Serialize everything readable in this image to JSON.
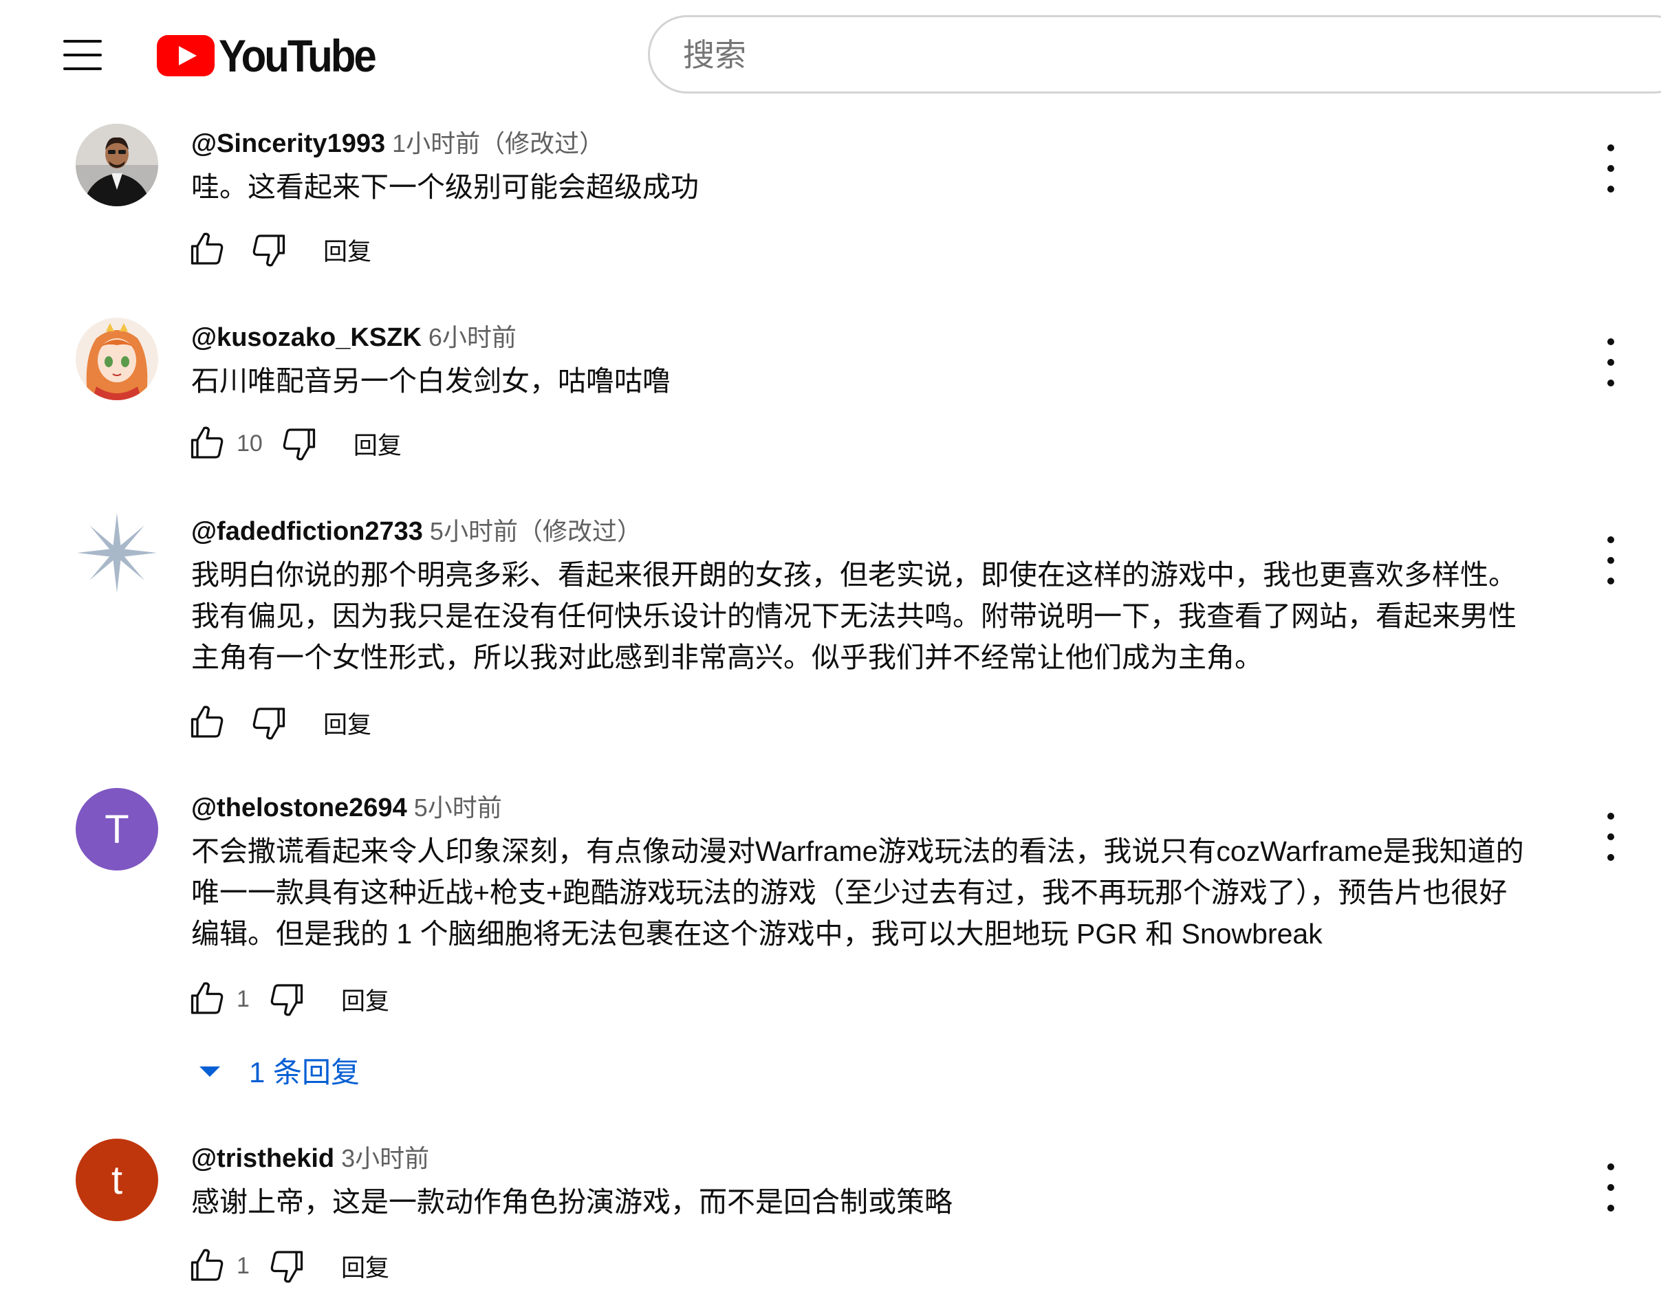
{
  "app": {
    "logo_text": "YouTube",
    "search_placeholder": "搜索"
  },
  "comments": [
    {
      "author": "@Sincerity1993",
      "time": "1小时前（修改过）",
      "lines": [
        "哇。这看起来下一个级别可能会超级成功"
      ],
      "likes": "",
      "reply_label": "回复",
      "avatar": {
        "type": "photo",
        "icon": "man-in-suit-avatar"
      }
    },
    {
      "author": "@kusozako_KSZK",
      "time": "6小时前",
      "lines": [
        "石川唯配音另一个白发剑女，咕噜咕噜"
      ],
      "likes": "10",
      "reply_label": "回复",
      "avatar": {
        "type": "photo",
        "icon": "anime-girl-avatar"
      }
    },
    {
      "author": "@fadedfiction2733",
      "time": "5小时前（修改过）",
      "lines": [
        "我明白你说的那个明亮多彩、看起来很开朗的女孩，但老实说，即使在这样的游戏中，我也更喜欢多样性。",
        "我有偏见，因为我只是在没有任何快乐设计的情况下无法共鸣。附带说明一下，我查看了网站，看起来男性",
        "主角有一个女性形式，所以我对此感到非常高兴。似乎我们并不经常让他们成为主角。"
      ],
      "likes": "",
      "reply_label": "回复",
      "avatar": {
        "type": "photo",
        "icon": "snowflake-star-avatar"
      }
    },
    {
      "author": "@thelostone2694",
      "time": "5小时前",
      "lines": [
        "不会撒谎看起来令人印象深刻，有点像动漫对Warframe游戏玩法的看法，我说只有cozWarframe是我知道的",
        "唯一一款具有这种近战+枪支+跑酷游戏玩法的游戏（至少过去有过，我不再玩那个游戏了），预告片也很好",
        "编辑。但是我的 1 个脑细胞将无法包裹在这个游戏中，我可以大胆地玩 PGR 和 Snowbreak"
      ],
      "likes": "1",
      "reply_label": "回复",
      "replies_toggle": "1 条回复",
      "avatar": {
        "type": "letter",
        "letter": "T",
        "color": "#7e57c2"
      }
    },
    {
      "author": "@tristhekid",
      "time": "3小时前",
      "lines": [
        "感谢上帝，这是一款动作角色扮演游戏，而不是回合制或策略"
      ],
      "likes": "1",
      "reply_label": "回复",
      "avatar": {
        "type": "letter",
        "letter": "t",
        "color": "#c0360c"
      }
    }
  ]
}
